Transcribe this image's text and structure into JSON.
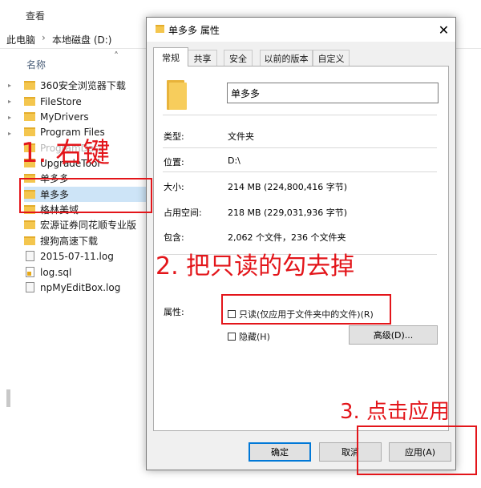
{
  "explorer": {
    "ribbon_view_label": "查看",
    "breadcrumb": [
      "此电脑",
      "本地磁盘 (D:)"
    ],
    "breadcrumb_sep": "›",
    "column_name_header": "名称",
    "sort_caret": "˄",
    "files": [
      {
        "name": "360安全浏览器下载",
        "type": "folder"
      },
      {
        "name": "FileStore",
        "type": "folder"
      },
      {
        "name": "MyDrivers",
        "type": "folder"
      },
      {
        "name": "Program Files",
        "type": "folder"
      },
      {
        "name": "ProgramData",
        "type": "folder"
      },
      {
        "name": "UpgradeTool",
        "type": "folder"
      },
      {
        "name": "单多多",
        "type": "folder",
        "selected": true
      },
      {
        "name": "格林美域",
        "type": "folder"
      },
      {
        "name": "宏源证券同花顺专业版",
        "type": "folder"
      },
      {
        "name": "搜狗高速下载",
        "type": "folder"
      },
      {
        "name": "2015-07-11.log",
        "type": "log"
      },
      {
        "name": "log.sql",
        "type": "sql"
      },
      {
        "name": "npMyEditBox.log",
        "type": "log"
      }
    ]
  },
  "dialog": {
    "title": "单多多 属性",
    "close_glyph": "✕",
    "tabs": [
      {
        "label": "常规",
        "active": true
      },
      {
        "label": "共享",
        "active": false
      },
      {
        "label": "安全",
        "active": false
      },
      {
        "label": "以前的版本",
        "active": false
      },
      {
        "label": "自定义",
        "active": false
      }
    ],
    "folder_name_value": "单多多",
    "properties": {
      "type_label": "类型:",
      "type_value": "文件夹",
      "location_label": "位置:",
      "location_value": "D:\\",
      "size_label": "大小:",
      "size_value": "214 MB (224,800,416 字节)",
      "size_on_disk_label": "占用空间:",
      "size_on_disk_value": "218 MB (229,031,936 字节)",
      "contains_label": "包含:",
      "contains_value": "2,062 个文件，236 个文件夹"
    },
    "attributes": {
      "label": "属性:",
      "readonly_label": "只读(仅应用于文件夹中的文件)(R)",
      "readonly_checked": false,
      "hidden_label": "隐藏(H)",
      "hidden_checked": false,
      "advanced_button": "高级(D)..."
    },
    "buttons": {
      "ok": "确定",
      "cancel": "取消",
      "apply": "应用(A)"
    }
  },
  "annotations": {
    "step1": "1. 右键",
    "step2": "2. 把只读的勾去掉",
    "step3": "3. 点击应用",
    "color": "#e3151a"
  }
}
